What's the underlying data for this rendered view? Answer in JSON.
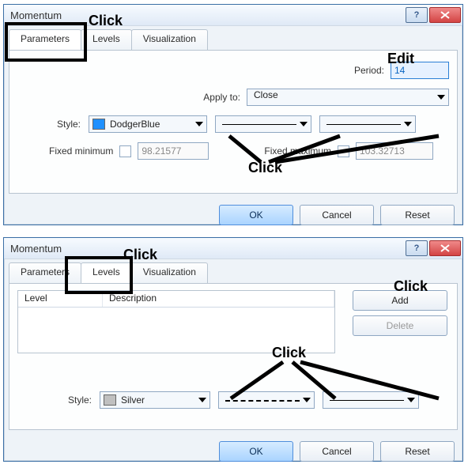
{
  "dialog1": {
    "title": "Momentum",
    "tabs": {
      "parameters": "Parameters",
      "levels": "Levels",
      "visualization": "Visualization"
    },
    "period_label": "Period:",
    "period_value": "14",
    "apply_label": "Apply to:",
    "apply_value": "Close",
    "style_label": "Style:",
    "style_color_name": "DodgerBlue",
    "fixed_min_label": "Fixed minimum",
    "fixed_min_value": "98.21577",
    "fixed_max_label": "Fixed maximum",
    "fixed_max_value": "103.32713",
    "ok": "OK",
    "cancel": "Cancel",
    "reset": "Reset"
  },
  "dialog2": {
    "title": "Momentum",
    "tabs": {
      "parameters": "Parameters",
      "levels": "Levels",
      "visualization": "Visualization"
    },
    "col_level": "Level",
    "col_desc": "Description",
    "add": "Add",
    "delete": "Delete",
    "style_label": "Style:",
    "style_color_name": "Silver",
    "ok": "OK",
    "cancel": "Cancel",
    "reset": "Reset"
  },
  "annotations": {
    "click": "Click",
    "edit": "Edit"
  }
}
